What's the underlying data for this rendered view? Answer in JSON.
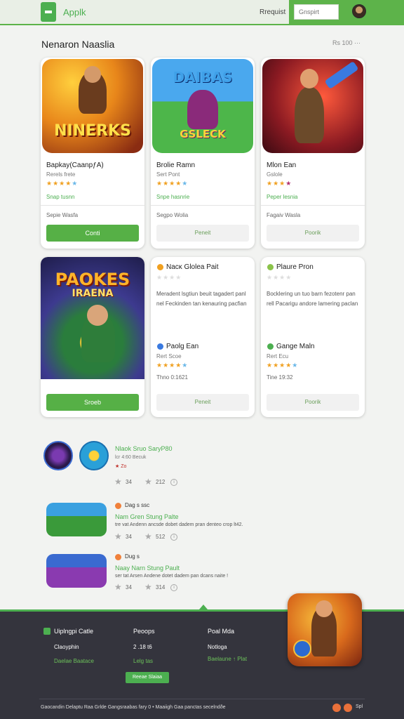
{
  "header": {
    "app_name": "Applk",
    "link": "Rrequist",
    "search_placeholder": "Gnspirt"
  },
  "section": {
    "title": "Nenaron Naaslia",
    "meta": "Rs 100  ···"
  },
  "cards_top": [
    {
      "art_title": "NINERKS",
      "title": "Bapkay(CaanpƒA)",
      "sub": "Rerels frete",
      "rating": 4,
      "tag": "Snap tusnn",
      "meta": "Sepie Wasfa",
      "button": "Conti",
      "button_style": "green"
    },
    {
      "art_title": "DAIBAS",
      "art_sub": "GSLECK",
      "title": "Brolie Ramn",
      "sub": "Sert Pont",
      "rating": 4,
      "tag": "Snpe hasnrie",
      "meta": "Segpo Wolia",
      "button": "Peneit",
      "button_style": "grey"
    },
    {
      "art_title": "",
      "title": "Mlon Ean",
      "sub": "Gslole",
      "rating": 4,
      "tag": "Peper lesnia",
      "meta": "Fagaiv Wasla",
      "button": "Poorik",
      "button_style": "grey"
    }
  ],
  "cards_bottom": [
    {
      "art_title": "PAOKES",
      "art_sub": "IRAENA",
      "button": "Sroeb"
    },
    {
      "title": "Nacĸ Glolea Pait",
      "desc": "Meradent lsgtiun beuit tagadert panl nel Feckinden tan kenauring pacfian",
      "sub_title": "Paolg Ean",
      "sub_sub": "Rert Scoe",
      "rating": 4,
      "meta": "Thno 0:1621",
      "button": "Peneit"
    },
    {
      "title": "Plaure Pron",
      "desc": "Bocklering un tuo barn fezotenr pan rell Pacarigu andore lamering paclan",
      "sub_title": "Gange Maln",
      "sub_sub": "Rert Ecu",
      "rating": 4,
      "meta": "Tine 19:32",
      "button": "Poorik"
    }
  ],
  "list": [
    {
      "title": "Nlaok Sruo SaryP80",
      "sub": "lcr 4:60  Becuk",
      "badge": "★ Zo",
      "stat1": "34",
      "stat2": "212"
    },
    {
      "tag": "Dag  s  ssc",
      "title": "Nam Gren Stung Palte",
      "desc": "tre vat Andenn ancsde dobet dadem pran denteo crop lt42.",
      "stat1": "34",
      "stat2": "512"
    },
    {
      "tag": "Dug  s",
      "title": "Naay Narn Stung Pault",
      "desc": "ser tat Arsen Andene dotet dadem pan dcans naite !",
      "stat1": "34",
      "stat2": "314"
    }
  ],
  "footer": {
    "col1_title": "Uiplngpi Catle",
    "col1_item1": "Claoyphin",
    "col1_item2": "Daelae Baatace",
    "col2_title": "Peoops",
    "col2_item1": "2 .18 t6",
    "col2_item2": "Lelg tas",
    "col3_title": "Poal Mda",
    "col3_item1": "Notloga",
    "col3_item2": "Baelaune ↑ Plat",
    "button": "Reeae Slaiaa",
    "copyright": "Gaocandin Delaptu Raa Grlde Gangsraabas fary 0 • Maaiigh Gaa panctas secelndðe",
    "social": "Spl"
  },
  "colors": {
    "accent": "#4caf50",
    "footer_bg": "#34343d",
    "star": "#f0a020"
  }
}
